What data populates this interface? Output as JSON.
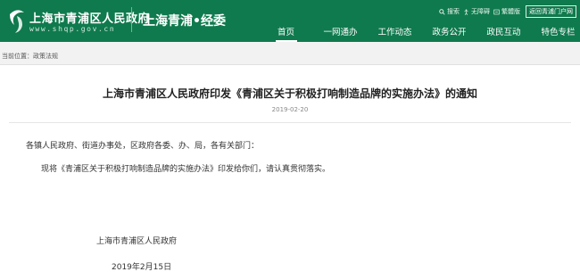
{
  "header": {
    "site_title": "上海市青浦区人民政府",
    "site_url": "www.shqp.gov.cn",
    "sub_site": "上海青浦•经委",
    "brand_color": "#0f7a4d"
  },
  "topbar": {
    "search": "搜索",
    "accessibility": "无障碍",
    "version": "繁體版",
    "return": "返回青浦门户网"
  },
  "nav": {
    "items": [
      {
        "label": "首页",
        "active": true
      },
      {
        "label": "一网通办",
        "active": false
      },
      {
        "label": "工作动态",
        "active": false
      },
      {
        "label": "政务公开",
        "active": false
      },
      {
        "label": "政民互动",
        "active": false
      },
      {
        "label": "特色专栏",
        "active": false
      }
    ]
  },
  "breadcrumb": {
    "text": "当前位置：政策法规"
  },
  "article": {
    "title": "上海市青浦区人民政府印发《青浦区关于积极打响制造品牌的实施办法》的通知",
    "date": "2019-02-20",
    "para1": "各镇人民政府、街道办事处，区政府各委、办、局，各有关部门：",
    "para2": "现将《青浦区关于积极打响制造品牌的实施办法》印发给你们，请认真贯彻落实。",
    "sign_org": "上海市青浦区人民政府",
    "sign_date": "2019年2月15日"
  }
}
